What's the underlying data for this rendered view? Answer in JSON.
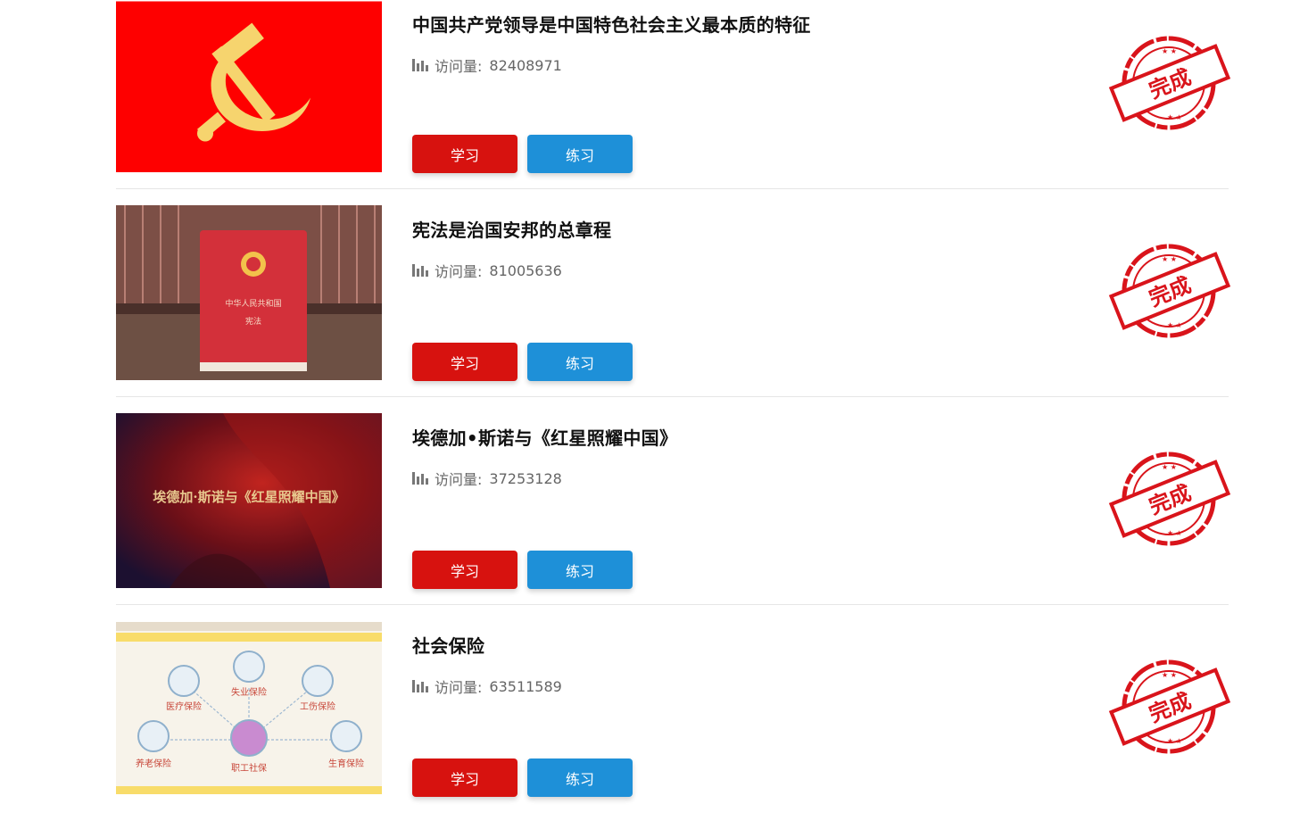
{
  "items": [
    {
      "title": "中国共产党领导是中国特色社会主义最本质的特征",
      "views_label": "访问量:",
      "views": "82408971",
      "study_label": "学习",
      "practice_label": "练习",
      "stamp_text": "完成"
    },
    {
      "title": "宪法是治国安邦的总章程",
      "views_label": "访问量:",
      "views": "81005636",
      "study_label": "学习",
      "practice_label": "练习",
      "stamp_text": "完成",
      "thumb_text": [
        "中华人民共和国",
        "宪法"
      ]
    },
    {
      "title": "埃德加•斯诺与《红星照耀中国》",
      "views_label": "访问量:",
      "views": "37253128",
      "study_label": "学习",
      "practice_label": "练习",
      "stamp_text": "完成",
      "thumb_text": "埃德加·斯诺与《红星照耀中国》"
    },
    {
      "title": "社会保险",
      "views_label": "访问量:",
      "views": "63511589",
      "study_label": "学习",
      "practice_label": "练习",
      "stamp_text": "完成",
      "thumb_text": [
        "失业保险",
        "医疗保险",
        "工伤保险",
        "养老保险",
        "职工社保",
        "生育保险"
      ]
    }
  ],
  "icons": {
    "views": "bar-chart-icon",
    "stamp": "completed-stamp"
  },
  "colors": {
    "study_button": "#d7120f",
    "practice_button": "#1e90d8",
    "stamp": "#d9141b"
  }
}
